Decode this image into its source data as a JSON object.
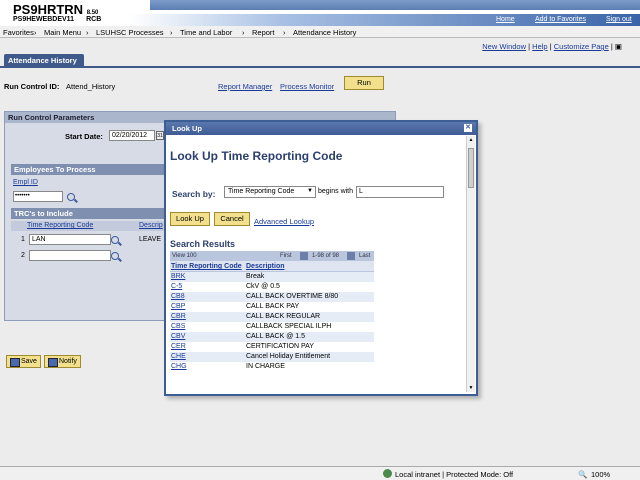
{
  "header": {
    "brand": "PS9HRTRN",
    "version": "8.50",
    "db": "PS9HEWEBDEV11",
    "user": "RCB",
    "links": [
      "Home",
      "Add to Favorites",
      "Sign out"
    ]
  },
  "menu": {
    "items": [
      "Favorites",
      "Main Menu",
      "LSUHSC Processes",
      "Time and Labor",
      "Report",
      "Attendance History"
    ],
    "separator": "›"
  },
  "page_links": {
    "new_window": "New Window",
    "help": "Help",
    "customize": "Customize Page",
    "sep": "|"
  },
  "tab": {
    "label": "Attendance History"
  },
  "run_control": {
    "label": "Run Control ID:",
    "value": "Attend_History",
    "report_manager": "Report Manager",
    "process_monitor": "Process Monitor",
    "run_label": "Run"
  },
  "params": {
    "title": "Run Control Parameters",
    "start_date_label": "Start Date:",
    "start_date_value": "02/20/2012",
    "employees_title": "Employees To Process",
    "empl_id_header": "Empl ID",
    "empl_id_value": "•••••••",
    "trcs_title": "TRC's to Include",
    "trc_col_header": "Time Reporting Code",
    "desc_col_header": "Descrip",
    "rows": [
      {
        "num": "1",
        "code": "LAN",
        "desc": "LEAVE"
      },
      {
        "num": "2",
        "code": "",
        "desc": ""
      }
    ]
  },
  "bottom_buttons": {
    "save": "Save",
    "notify": "Notify"
  },
  "modal": {
    "title": "Look Up",
    "close": "✕",
    "heading": "Look Up Time Reporting Code",
    "search_by_label": "Search by:",
    "search_by_value": "Time Reporting Code",
    "begins_with": "begins with",
    "search_value": "L",
    "lookup_label": "Look Up",
    "cancel_label": "Cancel",
    "advanced": "Advanced Lookup",
    "results_label": "Search Results",
    "grid": {
      "view": "View 100",
      "first": "First",
      "range": "1-98 of 98",
      "last": "Last",
      "col1": "Time Reporting Code",
      "col2": "Description",
      "rows": [
        {
          "code": "BRK",
          "desc": "Break"
        },
        {
          "code": "C-5",
          "desc": "CkV @ 0.5"
        },
        {
          "code": "CB8",
          "desc": "CALL BACK OVERTIME 8/80"
        },
        {
          "code": "CBP",
          "desc": "CALL BACK PAY"
        },
        {
          "code": "CBR",
          "desc": "CALL BACK REGULAR"
        },
        {
          "code": "CBS",
          "desc": "CALLBACK SPECIAL ILPH"
        },
        {
          "code": "CBV",
          "desc": "CALL BACK @ 1.5"
        },
        {
          "code": "CER",
          "desc": "CERTIFICATION PAY"
        },
        {
          "code": "CHE",
          "desc": "Cancel Holiday Entitlement"
        },
        {
          "code": "CHG",
          "desc": "IN CHARGE"
        }
      ]
    }
  },
  "status": {
    "zone": "Local intranet | Protected Mode: Off",
    "zoom": "100%"
  }
}
